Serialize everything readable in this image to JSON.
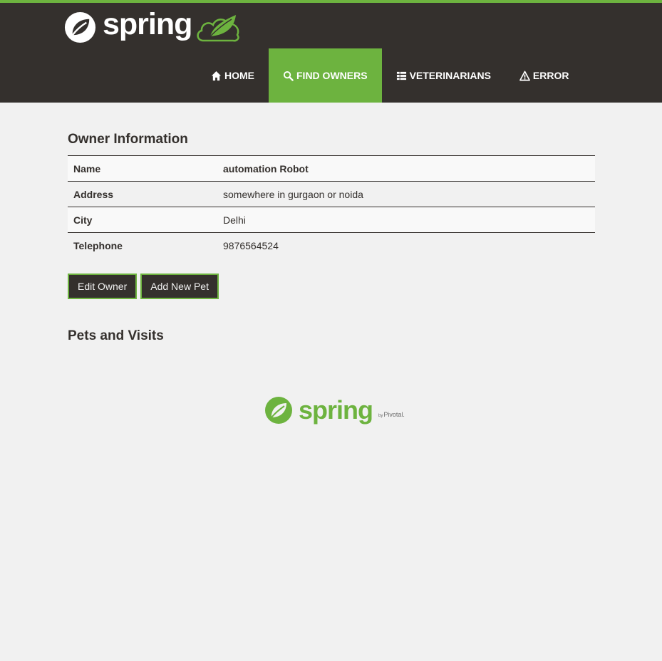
{
  "brand": {
    "name": "spring",
    "icon": "spring-leaf-icon",
    "badge_icon": "cloud-binary-icon"
  },
  "nav": {
    "items": [
      {
        "label": "Home",
        "icon": "home-icon"
      },
      {
        "label": "Find owners",
        "icon": "search-icon",
        "active": true
      },
      {
        "label": "Veterinarians",
        "icon": "list-icon"
      },
      {
        "label": "Error",
        "icon": "warning-icon"
      }
    ]
  },
  "owner": {
    "title": "Owner Information",
    "rows": [
      {
        "label": "Name",
        "value": "automation Robot"
      },
      {
        "label": "Address",
        "value": "somewhere in gurgaon or noida"
      },
      {
        "label": "City",
        "value": "Delhi"
      },
      {
        "label": "Telephone",
        "value": "9876564524"
      }
    ]
  },
  "buttons": {
    "edit_owner": "Edit Owner",
    "add_pet": "Add New Pet"
  },
  "pets": {
    "title": "Pets and Visits"
  },
  "footer": {
    "brand": "spring",
    "by": "by",
    "pivotal": "Pivotal."
  },
  "colors": {
    "accent": "#6db33f",
    "header_bg": "#34302d",
    "page_bg": "#f1f1f1"
  }
}
